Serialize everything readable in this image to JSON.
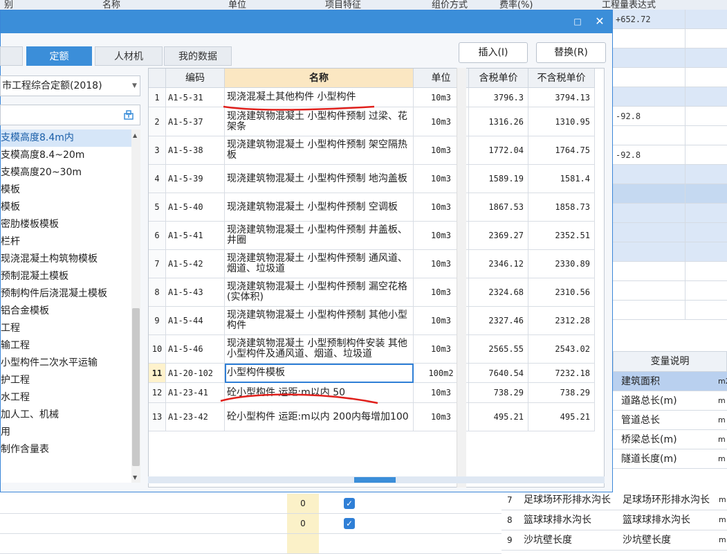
{
  "bg_header": {
    "col1": "别",
    "col2": "名称",
    "col3": "单位",
    "col4": "项目特征",
    "col5": "组价方式",
    "col6": "费率(%)",
    "col7": "工程量表达式"
  },
  "bg_right_rows": [
    "+652.72",
    "",
    "",
    "",
    "",
    "-92.8",
    "",
    "-92.8",
    "",
    "",
    "",
    "",
    "",
    "",
    "",
    ""
  ],
  "dialog": {
    "title_controls": {
      "maximize": "□",
      "close": "✕"
    },
    "tabs": [
      {
        "label": ""
      },
      {
        "label": "定额"
      },
      {
        "label": "人材机"
      },
      {
        "label": "我的数据"
      }
    ],
    "insert_label": "插入(I)",
    "replace_label": "替换(R)",
    "library": "市工程综合定额(2018)",
    "tree": [
      "支模高度8.4m内",
      "支模高度8.4~20m",
      "支模高度20~30m",
      "模板",
      "模板",
      "密肋楼板模板",
      "栏杆",
      "现浇混凝土构筑物模板",
      "预制混凝土模板",
      "预制构件后浇混凝土模板",
      "铝合金模板",
      "工程",
      "输工程",
      "小型构件二次水平运输",
      "护工程",
      "水工程",
      "加人工、机械",
      "用",
      "制作含量表"
    ],
    "columns": [
      "",
      "编码",
      "名称",
      "单位",
      "含税单价",
      "不含税单价"
    ],
    "rows": [
      {
        "idx": "1",
        "code": "A1-5-31",
        "name": "现浇混凝土其他构件 小型构件",
        "unit": "10m3",
        "tax": "3796.3",
        "notax": "3794.13"
      },
      {
        "idx": "2",
        "code": "A1-5-37",
        "name": "现浇建筑物混凝土 小型构件预制 过梁、花架条",
        "unit": "10m3",
        "tax": "1316.26",
        "notax": "1310.95"
      },
      {
        "idx": "3",
        "code": "A1-5-38",
        "name": "现浇建筑物混凝土 小型构件预制 架空隔热板",
        "unit": "10m3",
        "tax": "1772.04",
        "notax": "1764.75"
      },
      {
        "idx": "4",
        "code": "A1-5-39",
        "name": "现浇建筑物混凝土 小型构件预制 地沟盖板",
        "unit": "10m3",
        "tax": "1589.19",
        "notax": "1581.4"
      },
      {
        "idx": "5",
        "code": "A1-5-40",
        "name": "现浇建筑物混凝土 小型构件预制 空调板",
        "unit": "10m3",
        "tax": "1867.53",
        "notax": "1858.73"
      },
      {
        "idx": "6",
        "code": "A1-5-41",
        "name": "现浇建筑物混凝土 小型构件预制 井盖板、井圈",
        "unit": "10m3",
        "tax": "2369.27",
        "notax": "2352.51"
      },
      {
        "idx": "7",
        "code": "A1-5-42",
        "name": "现浇建筑物混凝土 小型构件预制 通风道、烟道、垃圾道",
        "unit": "10m3",
        "tax": "2346.12",
        "notax": "2330.89"
      },
      {
        "idx": "8",
        "code": "A1-5-43",
        "name": "现浇建筑物混凝土 小型构件预制 漏空花格(实体积)",
        "unit": "10m3",
        "tax": "2324.68",
        "notax": "2310.56"
      },
      {
        "idx": "9",
        "code": "A1-5-44",
        "name": "现浇建筑物混凝土 小型构件预制 其他小型构件",
        "unit": "10m3",
        "tax": "2327.46",
        "notax": "2312.28"
      },
      {
        "idx": "10",
        "code": "A1-5-46",
        "name": "现浇建筑物混凝土 小型预制构件安装 其他小型构件及通风道、烟道、垃圾道",
        "unit": "10m3",
        "tax": "2565.55",
        "notax": "2543.02"
      },
      {
        "idx": "11",
        "code": "A1-20-102",
        "name": "小型构件模板",
        "unit": "100m2",
        "tax": "7640.54",
        "notax": "7232.18"
      },
      {
        "idx": "12",
        "code": "A1-23-41",
        "name": "砼小型构件 运距:m以内 50",
        "unit": "10m3",
        "tax": "738.29",
        "notax": "738.29"
      },
      {
        "idx": "13",
        "code": "A1-23-42",
        "name": "砼小型构件 运距:m以内 200内每增加100",
        "unit": "10m3",
        "tax": "495.21",
        "notax": "495.21"
      }
    ]
  },
  "var_table": {
    "header": "变量说明",
    "rows": [
      {
        "label": "建筑面积",
        "unit": "m2"
      },
      {
        "label": "道路总长(m)",
        "unit": "m"
      },
      {
        "label": "管道总长",
        "unit": "m"
      },
      {
        "label": "桥梁总长(m)",
        "unit": "m"
      },
      {
        "label": "隧道长度(m)",
        "unit": "m"
      }
    ]
  },
  "bottom_rows": [
    {
      "zero": "0",
      "check": "✓"
    },
    {
      "zero": "0",
      "check": "✓"
    }
  ],
  "bottom_right": [
    {
      "n": "7",
      "a": "足球场环形排水沟长",
      "b": "足球场环形排水沟长",
      "u": "m"
    },
    {
      "n": "8",
      "a": "篮球球排水沟长",
      "b": "篮球球排水沟长",
      "u": "m"
    },
    {
      "n": "9",
      "a": "沙坑壁长度",
      "b": "沙坑壁长度",
      "u": "m"
    }
  ],
  "colors": {
    "accent": "#3b8ed9",
    "header_highlight": "#fbe7c2",
    "annotation": "#e0201c"
  }
}
